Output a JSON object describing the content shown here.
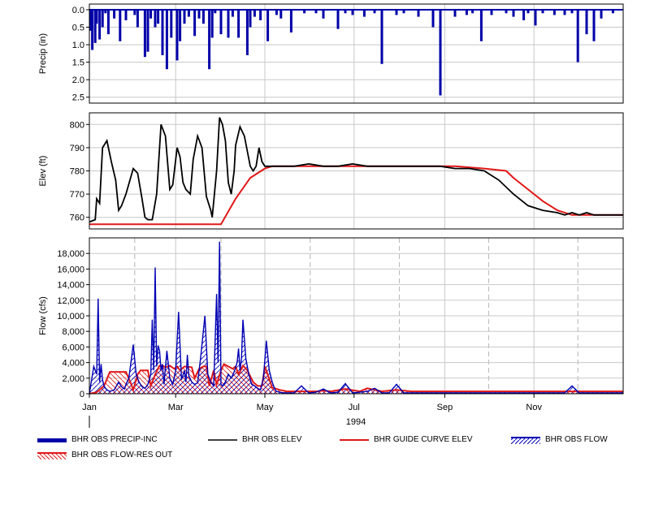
{
  "colors": {
    "precip": "#0000a8",
    "obs_elev": "#000000",
    "guide_curve": "#e01818",
    "obs_flow": "#0000b4",
    "flow_res_out": "#e01818",
    "grid": "#c8c8c8",
    "month_dash": "#b4b4b4"
  },
  "x_axis": {
    "month_labels": [
      "Jan",
      "Mar",
      "May",
      "Jul",
      "Sep",
      "Nov"
    ],
    "year_label": "1994",
    "range_days": [
      0,
      365
    ]
  },
  "legend": [
    {
      "name": "BHR OBS PRECIP-INC",
      "icon": "thick-blue-bar"
    },
    {
      "name": "BHR OBS ELEV",
      "icon": "black-line"
    },
    {
      "name": "BHR GUIDE CURVE ELEV",
      "icon": "red-line"
    },
    {
      "name": "BHR OBS FLOW",
      "icon": "blue-hatched-area"
    },
    {
      "name": "BHR OBS FLOW-RES OUT",
      "icon": "red-hatched-area"
    }
  ],
  "chart_data": [
    {
      "type": "bar",
      "ylabel": "Precip (in)",
      "y_inverted": true,
      "ylim": [
        0,
        2.6
      ],
      "yticks": [
        "0.0",
        "0.5",
        "1.0",
        "1.5",
        "2.0",
        "2.5"
      ],
      "grid": true,
      "series": [
        {
          "day": [
            1,
            2,
            4,
            5,
            7,
            9,
            11,
            13,
            17,
            21,
            25,
            31,
            33,
            38,
            40,
            42,
            45,
            47,
            50,
            53,
            56,
            60,
            62,
            65,
            68,
            72,
            75,
            78,
            82,
            84,
            86,
            90,
            95,
            98,
            102,
            108,
            110,
            113,
            117,
            122,
            128,
            131,
            138,
            147,
            155,
            160,
            170,
            175,
            180,
            188,
            195,
            200,
            210,
            215,
            225,
            235,
            240,
            250,
            258,
            262,
            268,
            275,
            285,
            290,
            297,
            300,
            305,
            310,
            318,
            325,
            330,
            334,
            340,
            345,
            350,
            358
          ],
          "values": [
            0.6,
            1.15,
            0.95,
            0.4,
            0.85,
            0.5,
            0.1,
            0.7,
            0.25,
            0.9,
            0.3,
            0.15,
            0.5,
            1.35,
            1.2,
            0.25,
            0.5,
            0.4,
            1.3,
            1.7,
            0.8,
            1.45,
            0.9,
            0.4,
            0.2,
            0.75,
            0.25,
            0.4,
            1.7,
            0.8,
            0.1,
            0.7,
            0.8,
            0.2,
            0.8,
            1.3,
            0.5,
            0.2,
            0.3,
            0.9,
            0.15,
            0.25,
            0.65,
            0.1,
            0.1,
            0.25,
            0.55,
            0.1,
            0.15,
            0.2,
            0.1,
            1.55,
            0.15,
            0.1,
            0.2,
            0.5,
            2.45,
            0.2,
            0.15,
            0.1,
            0.9,
            0.15,
            0.1,
            0.2,
            0.3,
            0.1,
            0.45,
            0.1,
            0.15,
            0.15,
            0.1,
            1.5,
            0.7,
            0.9,
            0.25,
            0.1
          ]
        }
      ]
    },
    {
      "type": "line",
      "ylabel": "Elev (ft)",
      "ylim": [
        755,
        805
      ],
      "yticks": [
        760,
        770,
        780,
        790,
        800
      ],
      "grid": true,
      "series": [
        {
          "name": "BHR OBS ELEV",
          "day": [
            0,
            4,
            5,
            7,
            9,
            12,
            15,
            18,
            20,
            22,
            25,
            30,
            33,
            36,
            38,
            40,
            43,
            46,
            49,
            52,
            55,
            57,
            60,
            62,
            64,
            66,
            69,
            71,
            74,
            77,
            80,
            83,
            84,
            87,
            89,
            91,
            93,
            95,
            97,
            99,
            100,
            103,
            106,
            110,
            112,
            114,
            116,
            118,
            120,
            122,
            125,
            128,
            135,
            140,
            150,
            160,
            170,
            180,
            190,
            200,
            210,
            220,
            230,
            240,
            250,
            260,
            270,
            280,
            290,
            300,
            310,
            320,
            325,
            330,
            335,
            340,
            345,
            350,
            355,
            360,
            365
          ],
          "values": [
            758,
            759,
            768,
            766,
            790,
            793,
            784,
            776,
            763,
            765,
            770,
            781,
            779,
            768,
            760,
            759,
            759,
            770,
            800,
            795,
            772,
            774,
            790,
            786,
            775,
            772,
            770,
            785,
            795,
            790,
            769,
            763,
            760,
            780,
            803,
            800,
            793,
            775,
            770,
            780,
            791,
            799,
            795,
            782,
            780,
            782,
            790,
            784,
            782,
            782,
            782,
            782,
            782,
            782,
            783,
            782,
            782,
            783,
            782,
            782,
            782,
            782,
            782,
            782,
            781,
            781,
            780,
            776,
            770,
            765,
            763,
            762,
            761,
            762,
            761,
            762,
            761,
            761,
            761,
            761,
            761
          ]
        },
        {
          "name": "BHR GUIDE CURVE ELEV",
          "day": [
            0,
            90,
            100,
            110,
            120,
            125,
            130,
            250,
            270,
            285,
            290,
            300,
            310,
            320,
            330,
            335,
            365
          ],
          "values": [
            757,
            757,
            768,
            777,
            781,
            782,
            782,
            782,
            781,
            780,
            777,
            772,
            767,
            763,
            761,
            761,
            761
          ]
        }
      ]
    },
    {
      "type": "area",
      "ylabel": "Flow (cfs)",
      "ylim": [
        0,
        20000
      ],
      "yticks": [
        "0",
        "2,000",
        "4,000",
        "6,000",
        "8,000",
        "10,000",
        "12,000",
        "14,000",
        "16,000",
        "18,000"
      ],
      "grid": true,
      "series": [
        {
          "name": "BHR OBS FLOW",
          "day": [
            0,
            3,
            5,
            6,
            7,
            8,
            9,
            10,
            11,
            12,
            14,
            17,
            20,
            22,
            24,
            25,
            27,
            30,
            32,
            34,
            36,
            38,
            40,
            42,
            43,
            44,
            45,
            46,
            47,
            48,
            49,
            50,
            51,
            53,
            55,
            57,
            59,
            61,
            63,
            65,
            66,
            67,
            68,
            70,
            72,
            74,
            76,
            79,
            81,
            83,
            85,
            87,
            88,
            89,
            90,
            91,
            93,
            95,
            97,
            99,
            101,
            102,
            103,
            104,
            105,
            107,
            109,
            111,
            113,
            115,
            117,
            119,
            121,
            123,
            125,
            126,
            127,
            128,
            130,
            133,
            136,
            140,
            145,
            150,
            155,
            160,
            165,
            170,
            175,
            180,
            185,
            190,
            195,
            200,
            205,
            210,
            215,
            225,
            235,
            240,
            245,
            250,
            255,
            260,
            265,
            270,
            280,
            290,
            300,
            310,
            320,
            325,
            330,
            335,
            340,
            350,
            365
          ],
          "values": [
            0,
            3500,
            2500,
            12200,
            1500,
            3800,
            1800,
            1000,
            700,
            500,
            300,
            500,
            1500,
            900,
            600,
            1200,
            2000,
            6300,
            2500,
            1500,
            900,
            700,
            1200,
            2500,
            9500,
            3000,
            16200,
            3500,
            6200,
            5500,
            3000,
            3800,
            1200,
            5500,
            2000,
            1200,
            3000,
            10500,
            1800,
            3000,
            1500,
            5000,
            2300,
            1500,
            1200,
            1400,
            4500,
            10000,
            2500,
            1500,
            1000,
            12800,
            4000,
            19500,
            1200,
            1000,
            1500,
            2500,
            2000,
            2800,
            4000,
            5800,
            3000,
            4500,
            9500,
            4500,
            2500,
            1200,
            1000,
            700,
            500,
            2000,
            6800,
            3000,
            1500,
            1000,
            500,
            300,
            200,
            100,
            100,
            100,
            1000,
            100,
            200,
            600,
            100,
            200,
            1300,
            100,
            200,
            300,
            700,
            100,
            100,
            1200,
            100,
            100,
            100,
            100,
            100,
            100,
            100,
            100,
            100,
            100,
            100,
            100,
            100,
            100,
            100,
            100,
            1000,
            100,
            100,
            100,
            100
          ]
        },
        {
          "name": "BHR OBS FLOW-RES OUT",
          "day": [
            0,
            5,
            10,
            14,
            15,
            20,
            25,
            28,
            30,
            33,
            35,
            40,
            42,
            45,
            48,
            50,
            52,
            55,
            58,
            60,
            62,
            65,
            70,
            72,
            75,
            78,
            80,
            82,
            85,
            87,
            90,
            92,
            95,
            98,
            100,
            102,
            105,
            108,
            112,
            115,
            118,
            120,
            125,
            130,
            135,
            140,
            145,
            155,
            160,
            165,
            175,
            185,
            190,
            200,
            210,
            220,
            230,
            240,
            250,
            260,
            270,
            280,
            290,
            300,
            310,
            320,
            330,
            340,
            350,
            365
          ],
          "values": [
            0,
            200,
            1000,
            2800,
            2800,
            2800,
            2800,
            1500,
            500,
            2500,
            3000,
            3000,
            1000,
            2500,
            3600,
            3600,
            3400,
            3600,
            3200,
            3500,
            3000,
            3500,
            3400,
            2000,
            3200,
            3500,
            3500,
            1000,
            3000,
            1200,
            3000,
            3800,
            3500,
            3200,
            3500,
            2500,
            3600,
            3000,
            1500,
            1000,
            1000,
            3500,
            800,
            500,
            300,
            300,
            300,
            300,
            400,
            300,
            600,
            300,
            700,
            300,
            500,
            300,
            300,
            300,
            300,
            300,
            300,
            300,
            300,
            300,
            300,
            300,
            300,
            300,
            300,
            300
          ]
        }
      ]
    }
  ]
}
